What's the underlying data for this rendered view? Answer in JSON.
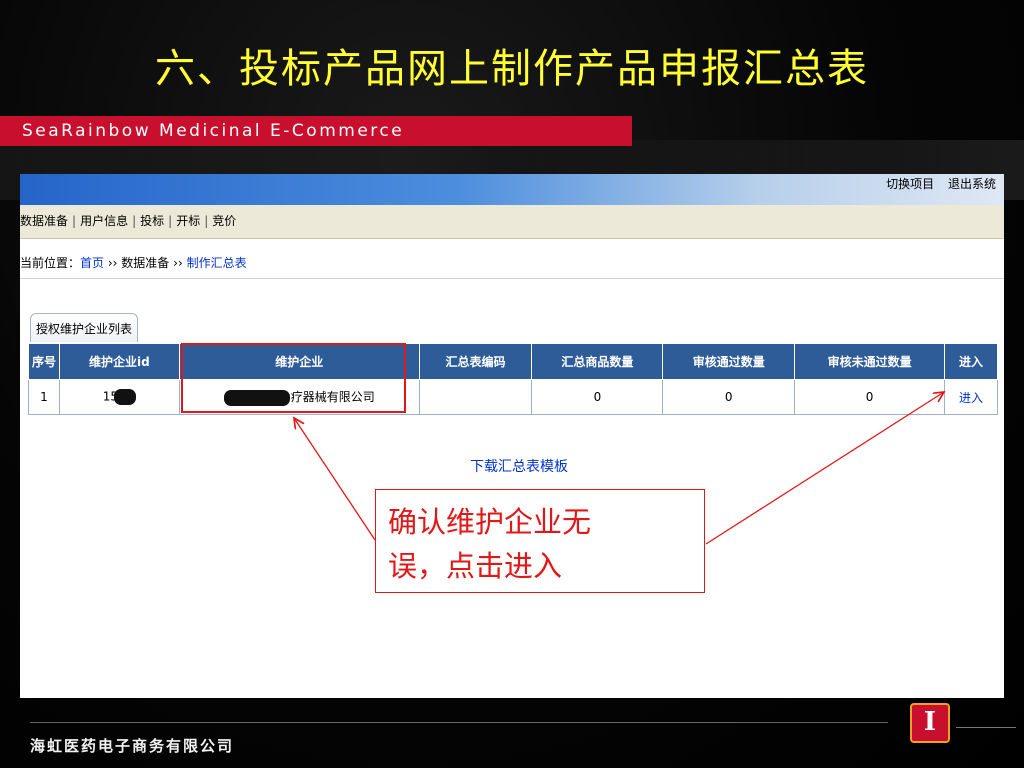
{
  "slide": {
    "title": "六、投标产品网上制作产品申报汇总表",
    "brand": "SeaRainbow Medicinal E-Commerce",
    "footer_company": "海虹医药电子商务有限公司",
    "accent_color": "#c8102e",
    "title_color": "#ffff33"
  },
  "app": {
    "top_links": [
      "切换项目",
      "退出系统"
    ],
    "menu": [
      "数据准备",
      "用户信息",
      "投标",
      "开标",
      "竞价"
    ],
    "breadcrumb": {
      "prefix": "当前位置：",
      "home": "首页",
      "sep": "››",
      "section": "数据准备",
      "current": "制作汇总表"
    },
    "tab_label": "授权维护企业列表",
    "table": {
      "headers": [
        "序号",
        "维护企业id",
        "维护企业",
        "汇总表编码",
        "汇总商品数量",
        "审核通过数量",
        "审核未通过数量",
        "进入"
      ],
      "rows": [
        {
          "index": "1",
          "company_id": "15",
          "company": "疗器械有限公司",
          "code": "",
          "total": "0",
          "approved": "0",
          "rejected": "0",
          "action": "进入"
        }
      ]
    },
    "download_link": "下载汇总表模板"
  },
  "annotation": {
    "callout_line1": "确认维护企业无",
    "callout_line2": "误，点击进入",
    "color": "#e01818"
  }
}
